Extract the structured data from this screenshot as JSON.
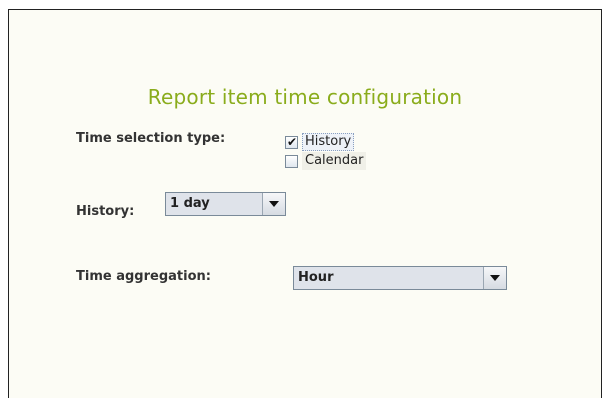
{
  "title": "Report item time configuration",
  "time_selection": {
    "label": "Time selection type:",
    "options": [
      {
        "label": "History",
        "checked": true
      },
      {
        "label": "Calendar",
        "checked": false
      }
    ]
  },
  "history": {
    "label": "History:",
    "selected": "1 day"
  },
  "aggregation": {
    "label": "Time aggregation:",
    "selected": "Hour"
  },
  "colors": {
    "title": "#8aac1c",
    "panel_background": "#fcfcf5"
  },
  "icons": {
    "dropdown": "chevron-down-icon",
    "check": "check-icon"
  }
}
